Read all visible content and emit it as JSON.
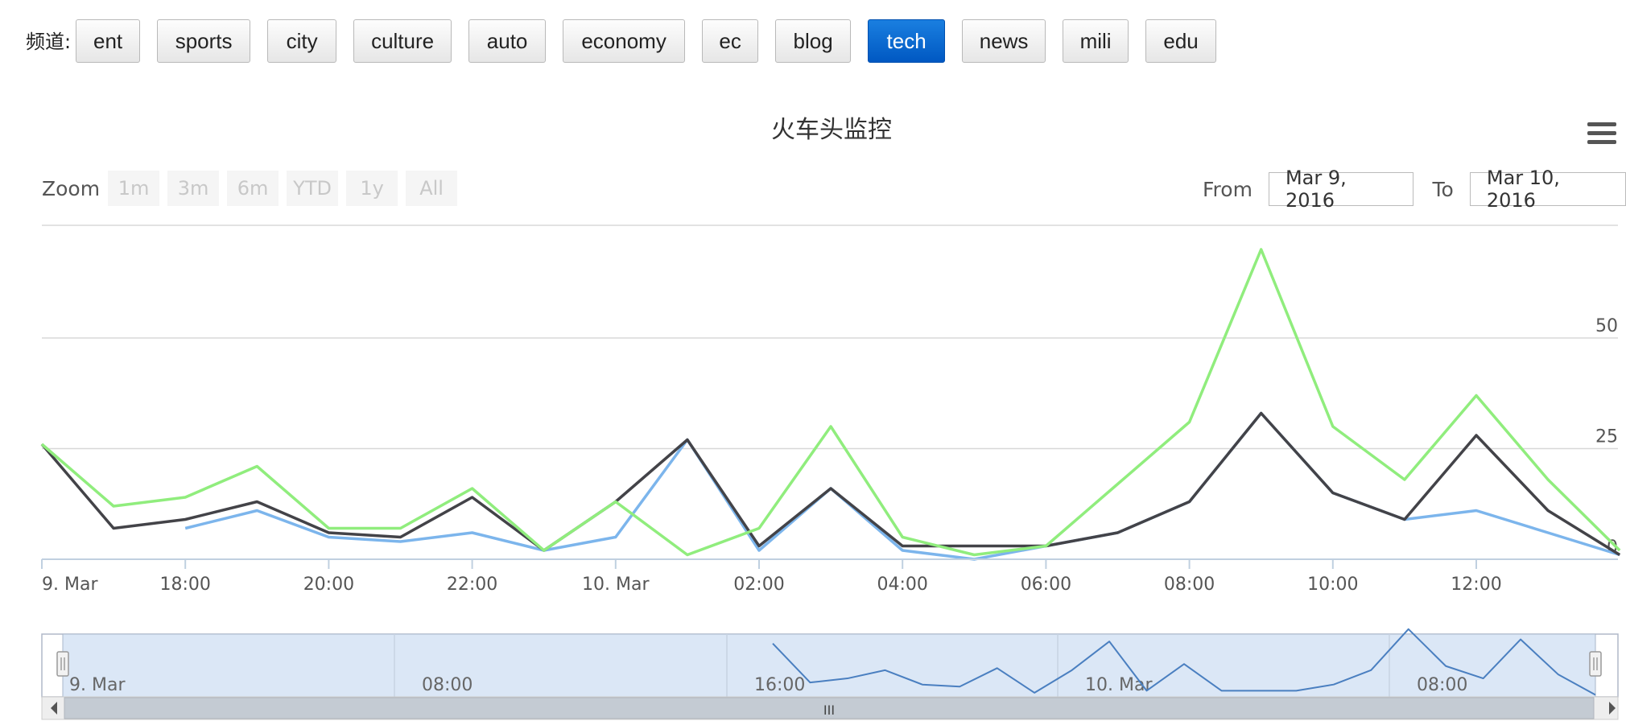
{
  "channel_bar": {
    "label": "频道:",
    "buttons": [
      "ent",
      "sports",
      "city",
      "culture",
      "auto",
      "economy",
      "ec",
      "blog",
      "tech",
      "news",
      "mili",
      "edu"
    ],
    "active": "tech",
    "active_color": "#0a6fd8"
  },
  "chart_toolbar": {
    "zoom_label": "Zoom",
    "zoom_buttons": [
      "1m",
      "3m",
      "6m",
      "YTD",
      "1y",
      "All"
    ],
    "from_label": "From",
    "from_value": "Mar 9, 2016",
    "to_label": "To",
    "to_value": "Mar 10, 2016"
  },
  "navigator": {
    "tick_labels": [
      "9. Mar",
      "08:00",
      "16:00",
      "10. Mar",
      "08:00"
    ],
    "scrollbar_grip": "III"
  },
  "chart_data": {
    "type": "line",
    "title": "火车头监控",
    "x_tick_labels": [
      "9. Mar",
      "18:00",
      "20:00",
      "22:00",
      "10. Mar",
      "02:00",
      "04:00",
      "06:00",
      "08:00",
      "10:00",
      "12:00"
    ],
    "x": [
      "2016-03-09 15:00",
      "2016-03-09 16:00",
      "2016-03-09 17:00",
      "2016-03-09 18:00",
      "2016-03-09 19:00",
      "2016-03-09 20:00",
      "2016-03-09 21:00",
      "2016-03-09 22:00",
      "2016-03-09 23:00",
      "2016-03-10 00:00",
      "2016-03-10 01:00",
      "2016-03-10 02:00",
      "2016-03-10 03:00",
      "2016-03-10 04:00",
      "2016-03-10 05:00",
      "2016-03-10 06:00",
      "2016-03-10 07:00",
      "2016-03-10 08:00",
      "2016-03-10 09:00",
      "2016-03-10 10:00",
      "2016-03-10 11:00",
      "2016-03-10 12:00",
      "2016-03-10 13:00"
    ],
    "ylim": [
      0,
      75
    ],
    "y_ticks": [
      0,
      25,
      50
    ],
    "grid": true,
    "series": [
      {
        "color": "#7cb5ec",
        "values": [
          null,
          null,
          7,
          11,
          5,
          4,
          6,
          2,
          5,
          27,
          2,
          16,
          2,
          0,
          3,
          6,
          13,
          33,
          15,
          9,
          11,
          6,
          1
        ]
      },
      {
        "color": "#434348",
        "values": [
          26,
          7,
          9,
          13,
          6,
          5,
          14,
          2,
          13,
          27,
          3,
          16,
          3,
          3,
          3,
          6,
          13,
          33,
          15,
          9,
          28,
          11,
          1
        ]
      },
      {
        "color": "#90ed7d",
        "values": [
          26,
          12,
          14,
          21,
          7,
          7,
          16,
          2,
          13,
          1,
          7,
          30,
          5,
          1,
          3,
          17,
          31,
          70,
          30,
          18,
          37,
          18,
          2
        ]
      }
    ]
  }
}
